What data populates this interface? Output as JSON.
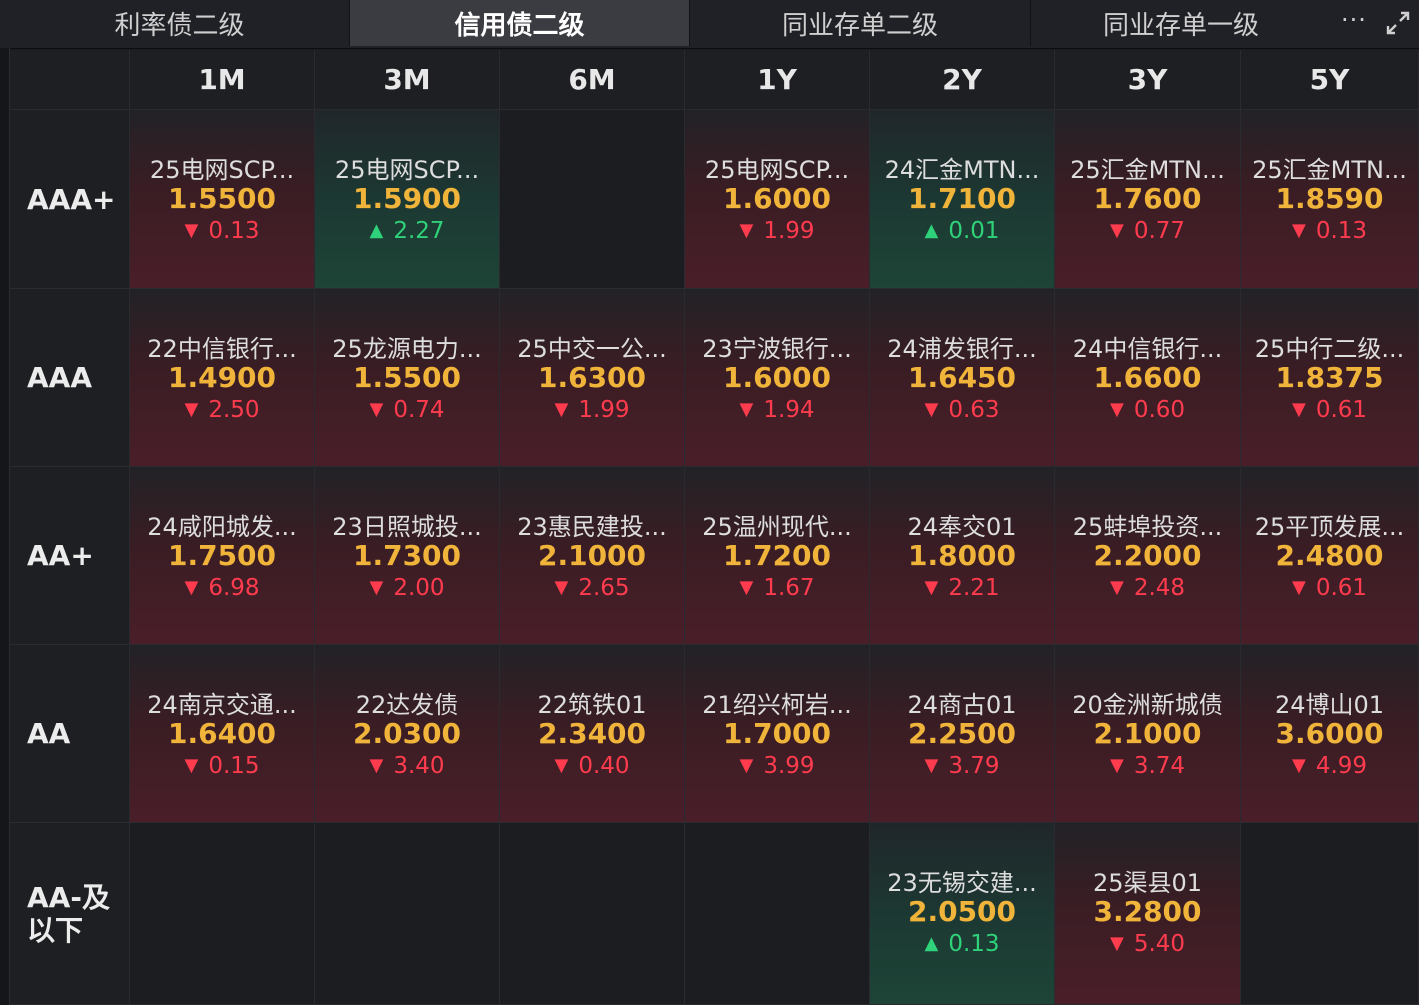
{
  "tabs": [
    {
      "label": "利率债二级",
      "active": false
    },
    {
      "label": "信用债二级",
      "active": true
    },
    {
      "label": "同业存单二级",
      "active": false
    },
    {
      "label": "同业存单一级",
      "active": false
    }
  ],
  "toolbar": {
    "more_label": "···"
  },
  "columns": [
    "1M",
    "3M",
    "6M",
    "1Y",
    "2Y",
    "3Y",
    "5Y"
  ],
  "rows": [
    {
      "rating": "AAA+",
      "cells": [
        {
          "name": "25电网SCP...",
          "rate": "1.5500",
          "change": "0.13",
          "dir": "down"
        },
        {
          "name": "25电网SCP...",
          "rate": "1.5900",
          "change": "2.27",
          "dir": "up"
        },
        null,
        {
          "name": "25电网SCP...",
          "rate": "1.6000",
          "change": "1.99",
          "dir": "down"
        },
        {
          "name": "24汇金MTN...",
          "rate": "1.7100",
          "change": "0.01",
          "dir": "up"
        },
        {
          "name": "25汇金MTN...",
          "rate": "1.7600",
          "change": "0.77",
          "dir": "down"
        },
        {
          "name": "25汇金MTN...",
          "rate": "1.8590",
          "change": "0.13",
          "dir": "down"
        }
      ]
    },
    {
      "rating": "AAA",
      "cells": [
        {
          "name": "22中信银行...",
          "rate": "1.4900",
          "change": "2.50",
          "dir": "down"
        },
        {
          "name": "25龙源电力...",
          "rate": "1.5500",
          "change": "0.74",
          "dir": "down"
        },
        {
          "name": "25中交一公...",
          "rate": "1.6300",
          "change": "1.99",
          "dir": "down"
        },
        {
          "name": "23宁波银行...",
          "rate": "1.6000",
          "change": "1.94",
          "dir": "down"
        },
        {
          "name": "24浦发银行...",
          "rate": "1.6450",
          "change": "0.63",
          "dir": "down"
        },
        {
          "name": "24中信银行...",
          "rate": "1.6600",
          "change": "0.60",
          "dir": "down"
        },
        {
          "name": "25中行二级...",
          "rate": "1.8375",
          "change": "0.61",
          "dir": "down"
        }
      ]
    },
    {
      "rating": "AA+",
      "cells": [
        {
          "name": "24咸阳城发...",
          "rate": "1.7500",
          "change": "6.98",
          "dir": "down"
        },
        {
          "name": "23日照城投...",
          "rate": "1.7300",
          "change": "2.00",
          "dir": "down"
        },
        {
          "name": "23惠民建投...",
          "rate": "2.1000",
          "change": "2.65",
          "dir": "down"
        },
        {
          "name": "25温州现代...",
          "rate": "1.7200",
          "change": "1.67",
          "dir": "down"
        },
        {
          "name": "24奉交01",
          "rate": "1.8000",
          "change": "2.21",
          "dir": "down"
        },
        {
          "name": "25蚌埠投资...",
          "rate": "2.2000",
          "change": "2.48",
          "dir": "down"
        },
        {
          "name": "25平顶发展...",
          "rate": "2.4800",
          "change": "0.61",
          "dir": "down"
        }
      ]
    },
    {
      "rating": "AA",
      "cells": [
        {
          "name": "24南京交通...",
          "rate": "1.6400",
          "change": "0.15",
          "dir": "down"
        },
        {
          "name": "22达发债",
          "rate": "2.0300",
          "change": "3.40",
          "dir": "down"
        },
        {
          "name": "22筑铁01",
          "rate": "2.3400",
          "change": "0.40",
          "dir": "down"
        },
        {
          "name": "21绍兴柯岩...",
          "rate": "1.7000",
          "change": "3.99",
          "dir": "down"
        },
        {
          "name": "24商古01",
          "rate": "2.2500",
          "change": "3.79",
          "dir": "down"
        },
        {
          "name": "20金洲新城债",
          "rate": "2.1000",
          "change": "3.74",
          "dir": "down"
        },
        {
          "name": "24博山01",
          "rate": "3.6000",
          "change": "4.99",
          "dir": "down"
        }
      ]
    },
    {
      "rating": "AA-及以下",
      "cells": [
        null,
        null,
        null,
        null,
        {
          "name": "23无锡交建...",
          "rate": "2.0500",
          "change": "0.13",
          "dir": "up"
        },
        {
          "name": "25渠县01",
          "rate": "3.2800",
          "change": "5.40",
          "dir": "down"
        },
        null
      ]
    }
  ]
}
